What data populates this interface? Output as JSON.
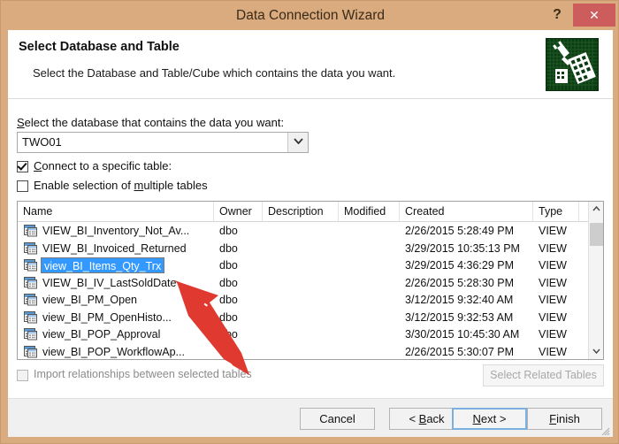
{
  "window": {
    "title": "Data Connection Wizard",
    "help_label": "?",
    "close_label": "✕",
    "titlebar_color": "#d9ab7e",
    "close_button_color": "#cd5c5c"
  },
  "header": {
    "title": "Select Database and Table",
    "subtitle": "Select the Database and Table/Cube which contains the data you want.",
    "icon": "database-connection-icon"
  },
  "database_section": {
    "label": "Select the database that contains the data you want:",
    "label_accesskey": "S",
    "selected_value": "TWO01",
    "dropdown_arrow": "chevron-down-icon",
    "connect_specific_table": {
      "label": "Connect to a specific table:",
      "accesskey": "C",
      "checked": true
    },
    "enable_multiple_tables": {
      "label": "Enable selection of multiple tables",
      "accesskey": "m",
      "checked": false
    }
  },
  "table_list": {
    "columns": [
      "Name",
      "Owner",
      "Description",
      "Modified",
      "Created",
      "Type"
    ],
    "selected_index": 2,
    "rows": [
      {
        "name": "VIEW_BI_Inventory_Not_Av...",
        "owner": "dbo",
        "description": "",
        "modified": "",
        "created": "2/26/2015 5:28:49 PM",
        "type": "VIEW"
      },
      {
        "name": "VIEW_BI_Invoiced_Returned",
        "owner": "dbo",
        "description": "",
        "modified": "",
        "created": "3/29/2015 10:35:13 PM",
        "type": "VIEW"
      },
      {
        "name": "view_BI_Items_Qty_Trx",
        "owner": "dbo",
        "description": "",
        "modified": "",
        "created": "3/29/2015 4:36:29 PM",
        "type": "VIEW"
      },
      {
        "name": "VIEW_BI_IV_LastSoldDate",
        "owner": "dbo",
        "description": "",
        "modified": "",
        "created": "2/26/2015 5:28:30 PM",
        "type": "VIEW"
      },
      {
        "name": "view_BI_PM_Open",
        "owner": "dbo",
        "description": "",
        "modified": "",
        "created": "3/12/2015 9:32:40 AM",
        "type": "VIEW"
      },
      {
        "name": "view_BI_PM_OpenHisto...",
        "owner": "dbo",
        "description": "",
        "modified": "",
        "created": "3/12/2015 9:32:53 AM",
        "type": "VIEW"
      },
      {
        "name": "view_BI_POP_Approval",
        "owner": "dbo",
        "description": "",
        "modified": "",
        "created": "3/30/2015 10:45:30 AM",
        "type": "VIEW"
      },
      {
        "name": "view_BI_POP_WorkflowAp...",
        "owner": "dbo",
        "description": "",
        "modified": "",
        "created": "2/26/2015 5:30:07 PM",
        "type": "VIEW"
      }
    ],
    "scrollbar": {
      "up_arrow": "chevron-up-icon",
      "down_arrow": "chevron-down-icon"
    },
    "selection_color": "#3399ff"
  },
  "footer": {
    "import_relationships": {
      "label": "Import relationships between selected tables",
      "checked": false,
      "disabled": true
    },
    "select_related_tables_label": "Select Related Tables",
    "select_related_tables_disabled": true
  },
  "buttons": {
    "cancel": "Cancel",
    "back": "< Back",
    "back_accesskey": "B",
    "next": "Next >",
    "next_accesskey": "N",
    "finish": "Finish",
    "finish_accesskey": "F",
    "default_button": "Next >"
  },
  "annotation": {
    "type": "red-arrow",
    "color": "#e0392f"
  }
}
